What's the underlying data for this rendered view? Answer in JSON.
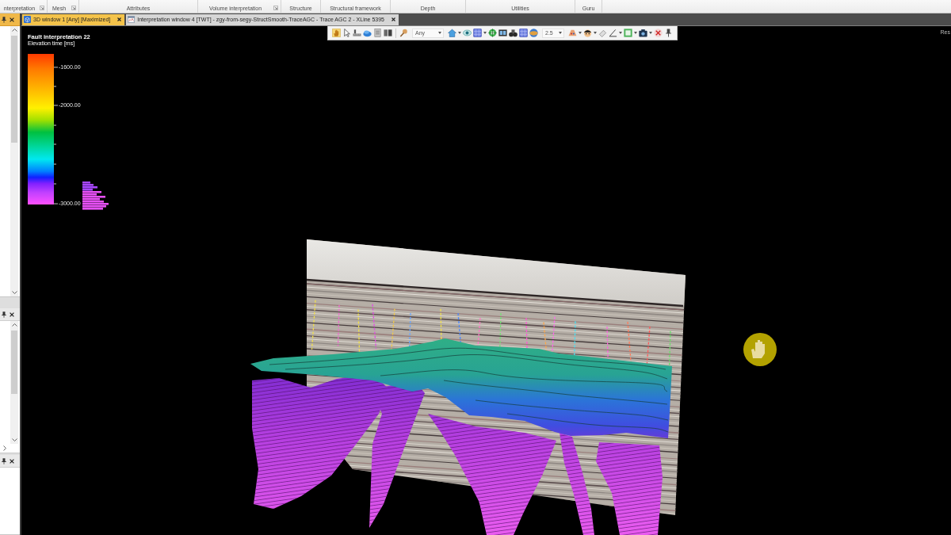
{
  "ribbon": {
    "groups": [
      {
        "label": "nterpretation",
        "launcher": true
      },
      {
        "label": "Mesh",
        "launcher": true
      },
      {
        "label": "Attributes",
        "launcher": false
      },
      {
        "label": "Volume interpretation",
        "launcher": true
      },
      {
        "label": "Structure",
        "launcher": false
      },
      {
        "label": "Structural framework",
        "launcher": false
      },
      {
        "label": "Depth",
        "launcher": false
      },
      {
        "label": "Utilities",
        "launcher": false
      },
      {
        "label": "Guru",
        "launcher": false
      }
    ]
  },
  "side_panels": [
    {
      "active": true,
      "vertical_scroll": true,
      "horizontal_scroll": false
    },
    {
      "active": false,
      "vertical_scroll": true,
      "horizontal_scroll": true
    },
    {
      "active": false,
      "vertical_scroll": false,
      "horizontal_scroll": false
    }
  ],
  "document_tabs": [
    {
      "kind": "viewer",
      "title": "3D window 1 [Any] [Maximized]",
      "selected": true
    },
    {
      "kind": "interpretation",
      "title": "Interpretation window 4 [TWT] - zgy-from-segy-StructSmooth-TraceAGC - Trace AGC 2 - XLine 5395",
      "selected": false
    }
  ],
  "viewport": {
    "toolbar": {
      "dropdowns": [
        {
          "value": "Any"
        },
        {
          "value": "2.5"
        }
      ]
    },
    "corner_label": "Res",
    "legend": {
      "title": "Fault interpretation 22",
      "subtitle": "Elevation time [ms]",
      "tick_labels": [
        "-1600.00",
        "-2000.00",
        "-3000.00"
      ]
    }
  }
}
